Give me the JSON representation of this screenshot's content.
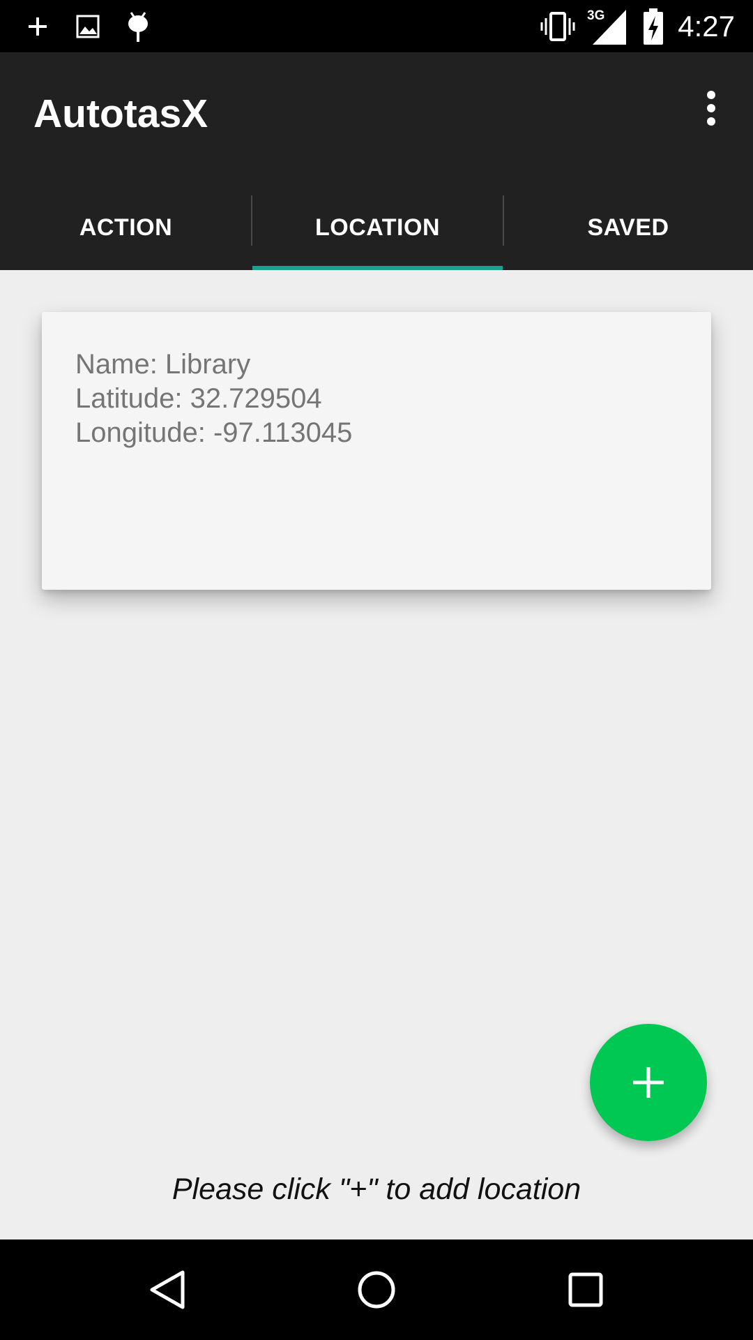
{
  "status_bar": {
    "left_icons": [
      "plus-icon",
      "image-icon",
      "android-debug-icon"
    ],
    "right_icons": [
      "vibrate-icon",
      "signal-3g-icon",
      "battery-charging-icon"
    ],
    "network_label": "3G",
    "time": "4:27"
  },
  "app_bar": {
    "title": "AutotasX",
    "overflow_icon": "more-vert-icon"
  },
  "tabs": [
    {
      "label": "ACTION",
      "selected": false
    },
    {
      "label": "LOCATION",
      "selected": true
    },
    {
      "label": "SAVED",
      "selected": false
    }
  ],
  "location_card": {
    "name_line": "Name: Library",
    "latitude_line": "Latitude: 32.729504",
    "longitude_line": "Longitude: -97.113045"
  },
  "fab": {
    "icon": "add-icon"
  },
  "hint": "Please click \"+\" to add location",
  "nav_bar": {
    "icons": [
      "back-icon",
      "home-icon",
      "recents-icon"
    ]
  },
  "colors": {
    "app_bar": "#212121",
    "accent_indicator": "#1aa18e",
    "fab": "#00c853",
    "background": "#eeeeee",
    "card": "#f5f5f5"
  }
}
